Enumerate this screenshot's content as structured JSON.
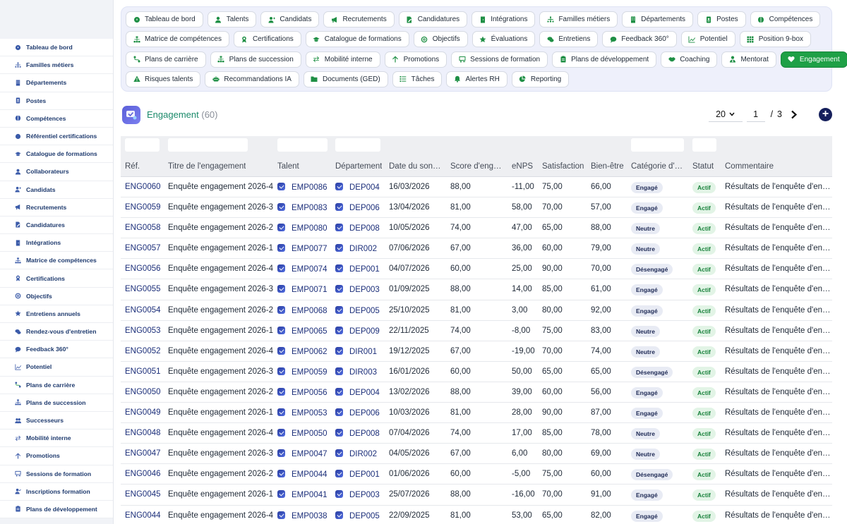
{
  "sidebar": {
    "items": [
      {
        "label": "Tableau de bord",
        "icon": "dashboard-icon"
      },
      {
        "label": "Familles métiers",
        "icon": "hierarchy-icon"
      },
      {
        "label": "Départements",
        "icon": "building-icon"
      },
      {
        "label": "Postes",
        "icon": "id-badge-icon"
      },
      {
        "label": "Compétences",
        "icon": "brain-icon"
      },
      {
        "label": "Référentiel certifications",
        "icon": "certificate-icon"
      },
      {
        "label": "Catalogue de formations",
        "icon": "graduation-cap-icon"
      },
      {
        "label": "Collaborateurs",
        "icon": "user-icon"
      },
      {
        "label": "Candidats",
        "icon": "user-plus-icon"
      },
      {
        "label": "Recrutements",
        "icon": "megaphone-icon"
      },
      {
        "label": "Candidatures",
        "icon": "file-signature-icon"
      },
      {
        "label": "Intégrations",
        "icon": "door-icon"
      },
      {
        "label": "Matrice de compétences",
        "icon": "sitemap-icon"
      },
      {
        "label": "Certifications",
        "icon": "award-icon"
      },
      {
        "label": "Objectifs",
        "icon": "target-icon"
      },
      {
        "label": "Entretiens annuels",
        "icon": "star-icon"
      },
      {
        "label": "Rendez-vous d'entretien",
        "icon": "chat-icon"
      },
      {
        "label": "Feedback 360°",
        "icon": "comment-icon"
      },
      {
        "label": "Potentiel",
        "icon": "chart-line-icon"
      },
      {
        "label": "Plans de carrière",
        "icon": "route-icon"
      },
      {
        "label": "Plans de succession",
        "icon": "sitemap-icon"
      },
      {
        "label": "Successeurs",
        "icon": "users-icon"
      },
      {
        "label": "Mobilité interne",
        "icon": "exchange-icon"
      },
      {
        "label": "Promotions",
        "icon": "arrow-up-icon"
      },
      {
        "label": "Sessions de formation",
        "icon": "chalkboard-icon"
      },
      {
        "label": "Inscriptions formation",
        "icon": "user-check-icon"
      },
      {
        "label": "Plans de développement",
        "icon": "clipboard-icon"
      }
    ]
  },
  "chips": [
    [
      {
        "label": "Tableau de bord",
        "icon": "dashboard-icon"
      },
      {
        "label": "Talents",
        "icon": "user-icon"
      },
      {
        "label": "Candidats",
        "icon": "user-plus-icon"
      },
      {
        "label": "Recrutements",
        "icon": "megaphone-icon"
      },
      {
        "label": "Candidatures",
        "icon": "file-signature-icon"
      },
      {
        "label": "Intégrations",
        "icon": "door-icon"
      },
      {
        "label": "Familles métiers",
        "icon": "hierarchy-icon"
      },
      {
        "label": "Départements",
        "icon": "building-icon"
      },
      {
        "label": "Postes",
        "icon": "id-badge-icon"
      },
      {
        "label": "Compétences",
        "icon": "brain-icon"
      }
    ],
    [
      {
        "label": "Matrice de compétences",
        "icon": "sitemap-icon"
      },
      {
        "label": "Certifications",
        "icon": "award-icon"
      },
      {
        "label": "Catalogue de formations",
        "icon": "graduation-cap-icon"
      },
      {
        "label": "Objectifs",
        "icon": "target-icon"
      },
      {
        "label": "Évaluations",
        "icon": "star-icon"
      },
      {
        "label": "Entretiens",
        "icon": "chat-icon"
      },
      {
        "label": "Feedback 360°",
        "icon": "comment-icon"
      },
      {
        "label": "Potentiel",
        "icon": "chart-line-icon"
      },
      {
        "label": "Position 9-box",
        "icon": "grid-icon"
      }
    ],
    [
      {
        "label": "Plans de carrière",
        "icon": "route-icon"
      },
      {
        "label": "Plans de succession",
        "icon": "sitemap-icon"
      },
      {
        "label": "Mobilité interne",
        "icon": "exchange-icon"
      },
      {
        "label": "Promotions",
        "icon": "arrow-up-icon"
      },
      {
        "label": "Sessions de formation",
        "icon": "chalkboard-icon"
      },
      {
        "label": "Plans de développement",
        "icon": "clipboard-icon"
      },
      {
        "label": "Coaching",
        "icon": "handshake-icon"
      },
      {
        "label": "Mentorat",
        "icon": "user-tie-icon"
      },
      {
        "label": "Engagement",
        "icon": "heart-icon",
        "active": true
      }
    ],
    [
      {
        "label": "Risques talents",
        "icon": "warning-icon"
      },
      {
        "label": "Recommandations IA",
        "icon": "robot-icon"
      },
      {
        "label": "Documents (GED)",
        "icon": "folder-icon"
      },
      {
        "label": "Tâches",
        "icon": "tasks-icon"
      },
      {
        "label": "Alertes RH",
        "icon": "bell-icon"
      },
      {
        "label": "Reporting",
        "icon": "pie-chart-icon"
      }
    ]
  ],
  "header": {
    "title": "Engagement",
    "count": "(60)",
    "page_size": "20",
    "page": "1",
    "page_sep": "/",
    "page_total": "3",
    "add_label": "+"
  },
  "table": {
    "columns": [
      "Réf.",
      "Titre de l'engagement",
      "Talent",
      "Département",
      "Date du son…",
      "Score d'eng…",
      "eNPS",
      "Satisfaction",
      "Bien-être",
      "Catégorie d'…",
      "Statut",
      "Commentaire"
    ],
    "rows": [
      [
        "ENG0060",
        "Enquête engagement 2026-4",
        "EMP0086",
        "DEP004",
        "16/03/2026",
        "88,00",
        "-11,00",
        "75,00",
        "66,00",
        "Engagé",
        "Actif",
        "Résultats de l'enquête d'engagement"
      ],
      [
        "ENG0059",
        "Enquête engagement 2026-3",
        "EMP0083",
        "DEP006",
        "13/04/2026",
        "81,00",
        "58,00",
        "70,00",
        "57,00",
        "Engagé",
        "Actif",
        "Résultats de l'enquête d'engagement"
      ],
      [
        "ENG0058",
        "Enquête engagement 2026-2",
        "EMP0080",
        "DEP008",
        "10/05/2026",
        "74,00",
        "47,00",
        "65,00",
        "88,00",
        "Neutre",
        "Actif",
        "Résultats de l'enquête d'engagement"
      ],
      [
        "ENG0057",
        "Enquête engagement 2026-1",
        "EMP0077",
        "DIR002",
        "07/06/2026",
        "67,00",
        "36,00",
        "60,00",
        "79,00",
        "Neutre",
        "Actif",
        "Résultats de l'enquête d'engagement"
      ],
      [
        "ENG0056",
        "Enquête engagement 2026-4",
        "EMP0074",
        "DEP001",
        "04/07/2026",
        "60,00",
        "25,00",
        "90,00",
        "70,00",
        "Désengagé",
        "Actif",
        "Résultats de l'enquête d'engagement"
      ],
      [
        "ENG0055",
        "Enquête engagement 2026-3",
        "EMP0071",
        "DEP003",
        "01/09/2025",
        "88,00",
        "14,00",
        "85,00",
        "61,00",
        "Engagé",
        "Actif",
        "Résultats de l'enquête d'engagement"
      ],
      [
        "ENG0054",
        "Enquête engagement 2026-2",
        "EMP0068",
        "DEP005",
        "25/10/2025",
        "81,00",
        "3,00",
        "80,00",
        "92,00",
        "Engagé",
        "Actif",
        "Résultats de l'enquête d'engagement"
      ],
      [
        "ENG0053",
        "Enquête engagement 2026-1",
        "EMP0065",
        "DEP009",
        "22/11/2025",
        "74,00",
        "-8,00",
        "75,00",
        "83,00",
        "Neutre",
        "Actif",
        "Résultats de l'enquête d'engagement"
      ],
      [
        "ENG0052",
        "Enquête engagement 2026-4",
        "EMP0062",
        "DIR001",
        "19/12/2025",
        "67,00",
        "-19,00",
        "70,00",
        "74,00",
        "Neutre",
        "Actif",
        "Résultats de l'enquête d'engagement"
      ],
      [
        "ENG0051",
        "Enquête engagement 2026-3",
        "EMP0059",
        "DIR003",
        "16/01/2026",
        "60,00",
        "50,00",
        "65,00",
        "65,00",
        "Désengagé",
        "Actif",
        "Résultats de l'enquête d'engagement"
      ],
      [
        "ENG0050",
        "Enquête engagement 2026-2",
        "EMP0056",
        "DEP004",
        "13/02/2026",
        "88,00",
        "39,00",
        "60,00",
        "56,00",
        "Engagé",
        "Actif",
        "Résultats de l'enquête d'engagement"
      ],
      [
        "ENG0049",
        "Enquête engagement 2026-1",
        "EMP0053",
        "DEP006",
        "10/03/2026",
        "81,00",
        "28,00",
        "90,00",
        "87,00",
        "Engagé",
        "Actif",
        "Résultats de l'enquête d'engagement"
      ],
      [
        "ENG0048",
        "Enquête engagement 2026-4",
        "EMP0050",
        "DEP008",
        "07/04/2026",
        "74,00",
        "17,00",
        "85,00",
        "78,00",
        "Neutre",
        "Actif",
        "Résultats de l'enquête d'engagement"
      ],
      [
        "ENG0047",
        "Enquête engagement 2026-3",
        "EMP0047",
        "DIR002",
        "04/05/2026",
        "67,00",
        "6,00",
        "80,00",
        "69,00",
        "Neutre",
        "Actif",
        "Résultats de l'enquête d'engagement"
      ],
      [
        "ENG0046",
        "Enquête engagement 2026-2",
        "EMP0044",
        "DEP001",
        "01/06/2026",
        "60,00",
        "-5,00",
        "75,00",
        "60,00",
        "Désengagé",
        "Actif",
        "Résultats de l'enquête d'engagement"
      ],
      [
        "ENG0045",
        "Enquête engagement 2026-1",
        "EMP0041",
        "DEP003",
        "25/07/2026",
        "88,00",
        "-16,00",
        "70,00",
        "91,00",
        "Engagé",
        "Actif",
        "Résultats de l'enquête d'engagement"
      ],
      [
        "ENG0044",
        "Enquête engagement 2026-4",
        "EMP0038",
        "DEP005",
        "22/09/2025",
        "81,00",
        "53,00",
        "65,00",
        "82,00",
        "Engagé",
        "Actif",
        "Résultats de l'enquête d'engagement"
      ]
    ]
  },
  "colors": {
    "accent_green": "#1fa046",
    "title_teal": "#1a8a6a",
    "link_navy": "#1c2f7a"
  }
}
